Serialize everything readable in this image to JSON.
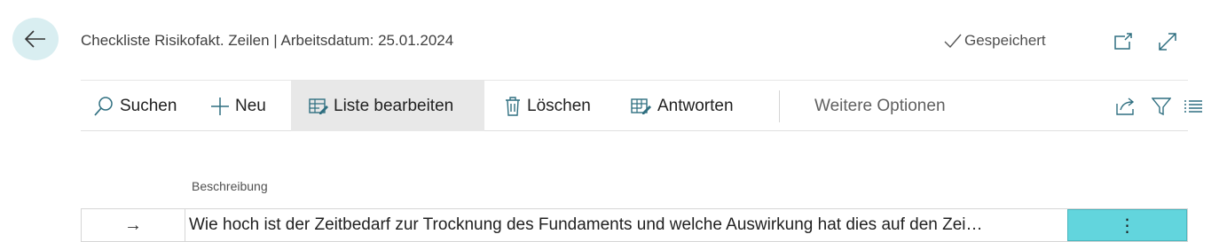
{
  "header": {
    "title": "Checkliste Risikofakt. Zeilen | Arbeitsdatum: 25.01.2024",
    "saved_status": "Gespeichert",
    "icons": [
      "back-arrow-icon",
      "checkmark-icon",
      "open-new-window-icon",
      "expand-icon"
    ]
  },
  "actions": {
    "search": "Suchen",
    "new": "Neu",
    "edit_list": "Liste bearbeiten",
    "delete": "Löschen",
    "answers": "Antworten",
    "more_options": "Weitere Optionen",
    "right_icons": [
      "share-icon",
      "filter-icon",
      "list-view-icon"
    ]
  },
  "table": {
    "columns": [
      "Beschreibung"
    ],
    "rows": [
      {
        "indicator": "→",
        "beschreibung": "Wie hoch ist der Zeitbedarf zur Trocknung des Fundaments und welche Auswirkung hat dies auf den Zei…",
        "menu": "⋮"
      }
    ]
  },
  "colors": {
    "back_button_bg": "#d9eef1",
    "active_action_bg": "#e8e8e8",
    "row_menu_bg": "#62d5dd",
    "icon_accent": "#2f6f80"
  }
}
